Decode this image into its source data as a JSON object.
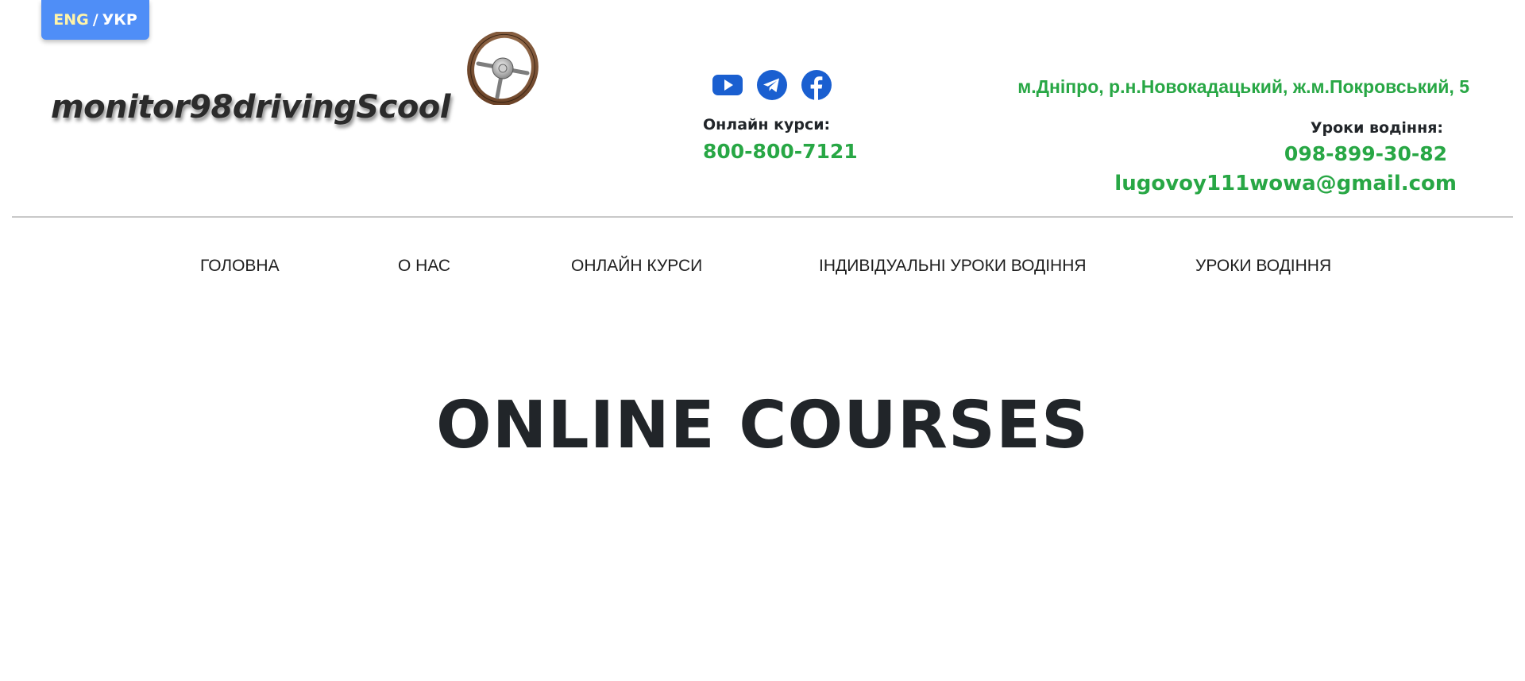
{
  "language_toggle": {
    "eng": "ENG",
    "separator": "/",
    "ukr": "УКР"
  },
  "logo": {
    "text": "monitor98drivingScool",
    "image_icon": "steering-wheel-icon"
  },
  "socials": [
    {
      "name": "YouTube",
      "icon": "youtube-icon"
    },
    {
      "name": "Telegram",
      "icon": "telegram-icon"
    },
    {
      "name": "Facebook",
      "icon": "facebook-icon"
    }
  ],
  "contacts": {
    "online_label": "Онлайн курси:",
    "online_phone": "800-800-7121",
    "address": "м.Дніпро, р.н.Новокадацький, ж.м.Покровський, 5",
    "lessons_label": "Уроки водіння:",
    "lessons_phone": "098-899-30-82",
    "email": "lugovoy111wowa@gmail.com"
  },
  "nav": {
    "items": [
      {
        "label": "ГОЛОВНА"
      },
      {
        "label": "О НАС"
      },
      {
        "label": "ОНЛАЙН КУРСИ"
      },
      {
        "label": "ІНДИВІДУАЛЬНІ УРОКИ ВОДІННЯ"
      },
      {
        "label": "УРОКИ ВОДІННЯ"
      }
    ]
  },
  "hero": {
    "title": "ONLINE COURSES"
  },
  "colors": {
    "accent_green": "#28a745",
    "icon_blue": "#1a5fd0",
    "toggle_blue": "#4f8ef7",
    "toggle_eng": "#fff4a8",
    "text_dark": "#212529"
  }
}
